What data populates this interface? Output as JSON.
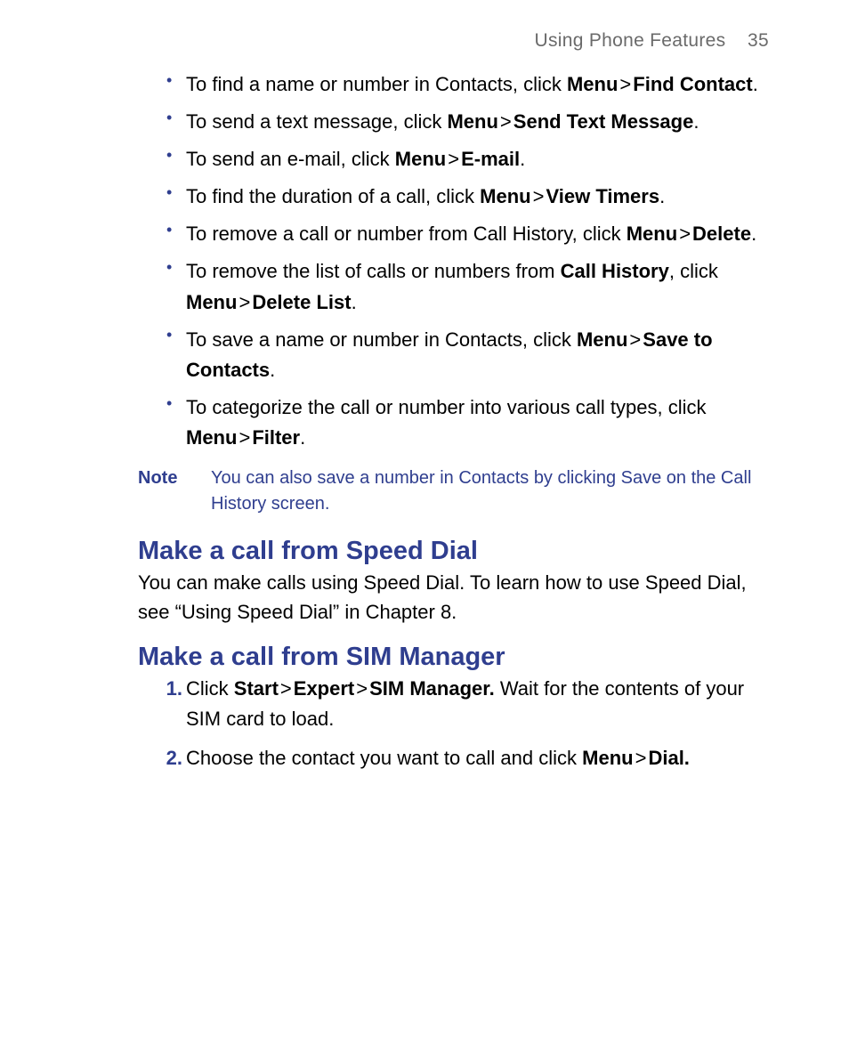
{
  "header": {
    "section": "Using Phone Features",
    "page": "35"
  },
  "bullets": [
    {
      "pre": "To find a name or number in Contacts, click ",
      "b1": "Menu",
      "gt": ">",
      "b2": "Find Contact",
      "post": "."
    },
    {
      "pre": "To send a text message, click ",
      "b1": "Menu",
      "gt": ">",
      "b2": "Send Text Message",
      "post": "."
    },
    {
      "pre": "To send an e-mail, click ",
      "b1": "Menu",
      "gt": ">",
      "b2": "E-mail",
      "post": "."
    },
    {
      "pre": "To find the duration of a call, click ",
      "b1": "Menu",
      "gt": ">",
      "b2": "View Timers",
      "post": "."
    },
    {
      "pre": "To remove a call or number from Call History, click ",
      "b1": "Menu",
      "gt": ">",
      "b2": "Delete",
      "post": "."
    },
    {
      "pre": "To remove the list of calls or numbers from ",
      "b0": "Call History",
      "mid": ", click ",
      "b1": "Menu",
      "gt": ">",
      "b2": "Delete List",
      "post": "."
    },
    {
      "pre": "To save a name or number in Contacts, click ",
      "b1": "Menu",
      "gt": ">",
      "b2": "Save to Contacts",
      "post": "."
    },
    {
      "pre": "To categorize the call or number into various call types, click ",
      "b1": "Menu",
      "gt": ">",
      "b2": "Filter",
      "post": "."
    }
  ],
  "note": {
    "label": "Note",
    "text": "You can also save a number in Contacts by clicking Save on the Call History screen."
  },
  "speedDial": {
    "heading": "Make a call from Speed Dial",
    "body": "You can make calls using Speed Dial. To learn how to use Speed Dial, see “Using Speed Dial” in Chapter 8."
  },
  "simManager": {
    "heading": "Make a call from SIM Manager",
    "steps": [
      {
        "pre": "Click ",
        "b1": "Start",
        "gt1": ">",
        "b2": "Expert",
        "gt2": ">",
        "b3": "SIM Manager.",
        "post": " Wait for the contents of your SIM card to load."
      },
      {
        "pre": "Choose the contact you want to call and click ",
        "b1": "Menu",
        "gt1": ">",
        "b2": "Dial.",
        "post": ""
      }
    ]
  }
}
